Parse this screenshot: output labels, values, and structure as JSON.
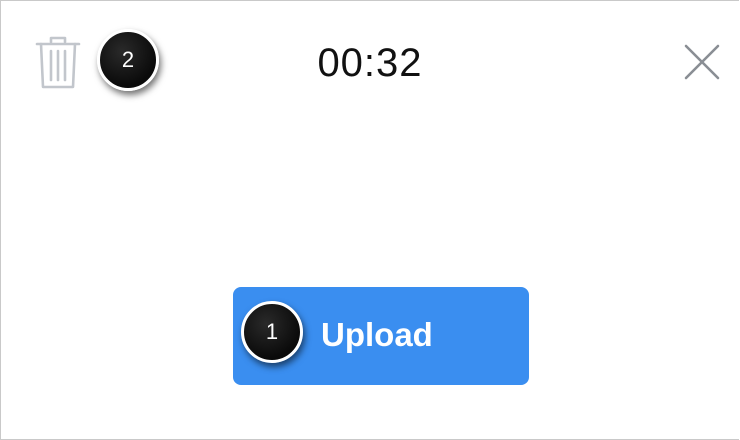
{
  "header": {
    "timer_text": "00:32",
    "delete_icon": "trash-icon",
    "close_icon": "close-icon"
  },
  "upload_button": {
    "label": "Upload",
    "color": "#3a8ef0"
  },
  "callouts": [
    {
      "number": "1",
      "target": "upload-button"
    },
    {
      "number": "2",
      "target": "delete-button"
    }
  ]
}
